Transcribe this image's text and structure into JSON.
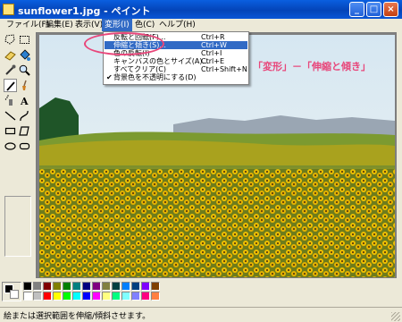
{
  "window": {
    "title": "sunflower1.jpg - ペイント"
  },
  "window_controls": {
    "minimize": "_",
    "maximize": "□",
    "close": "×"
  },
  "menu": [
    {
      "label": "ファイル(F)"
    },
    {
      "label": "編集(E)"
    },
    {
      "label": "表示(V)"
    },
    {
      "label": "変形(I)"
    },
    {
      "label": "色(C)"
    },
    {
      "label": "ヘルプ(H)"
    }
  ],
  "dropdown": {
    "items": [
      {
        "label": "反転と回転(F)...",
        "shortcut": "Ctrl+R",
        "checked": false
      },
      {
        "label": "伸縮と傾き(S)...",
        "shortcut": "Ctrl+W",
        "checked": false
      },
      {
        "label": "色の反転(I)",
        "shortcut": "Ctrl+I",
        "checked": false
      },
      {
        "label": "キャンバスの色とサイズ(A)...",
        "shortcut": "Ctrl+E",
        "checked": false
      },
      {
        "label": "すべてクリア(C)",
        "shortcut": "Ctrl+Shift+N",
        "checked": false
      },
      {
        "label": "背景色を不透明にする(D)",
        "shortcut": "",
        "checked": true
      }
    ],
    "check_mark": "✔"
  },
  "annotation": {
    "text": "「変形」－「伸縮と傾き」",
    "color": "#e8467a"
  },
  "tools": [
    {
      "icon": "free-select-icon"
    },
    {
      "icon": "rect-select-icon"
    },
    {
      "icon": "eraser-icon"
    },
    {
      "icon": "fill-icon"
    },
    {
      "icon": "color-picker-icon"
    },
    {
      "icon": "magnifier-icon"
    },
    {
      "icon": "pencil-icon"
    },
    {
      "icon": "brush-icon"
    },
    {
      "icon": "airbrush-icon"
    },
    {
      "icon": "text-icon"
    },
    {
      "icon": "line-icon"
    },
    {
      "icon": "curve-icon"
    },
    {
      "icon": "rectangle-icon"
    },
    {
      "icon": "polygon-icon"
    },
    {
      "icon": "ellipse-icon"
    },
    {
      "icon": "rounded-rect-icon"
    }
  ],
  "tool_text_glyph": "A",
  "palette": {
    "foreground": "#000000",
    "background": "#ffffff",
    "colors_top": [
      "#000000",
      "#808080",
      "#800000",
      "#808000",
      "#008000",
      "#008080",
      "#000080",
      "#800080",
      "#808040",
      "#004040",
      "#0080ff",
      "#004080",
      "#8000ff",
      "#804000"
    ],
    "colors_bottom": [
      "#ffffff",
      "#c0c0c0",
      "#ff0000",
      "#ffff00",
      "#00ff00",
      "#00ffff",
      "#0000ff",
      "#ff00ff",
      "#ffff80",
      "#00ff80",
      "#80ffff",
      "#8080ff",
      "#ff0080",
      "#ff8040"
    ]
  },
  "status": {
    "text": "絵または選択範囲を伸縮/傾斜させます。"
  }
}
